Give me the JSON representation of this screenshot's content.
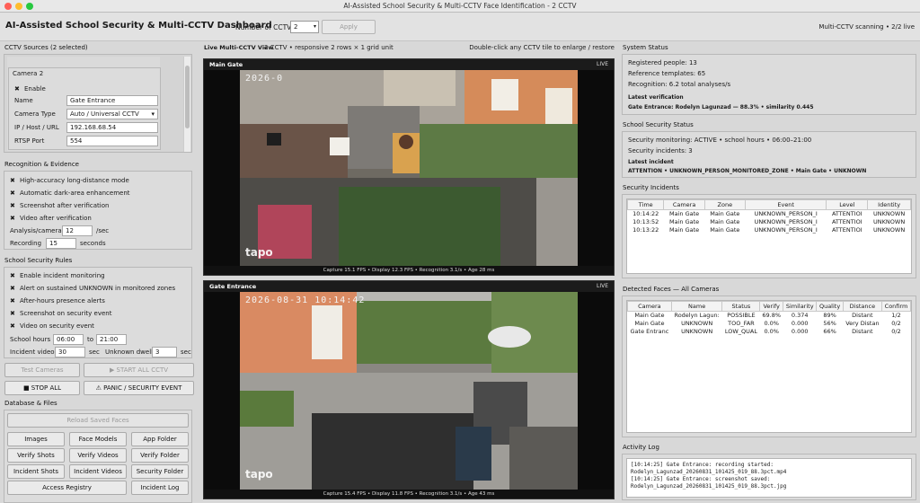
{
  "window": {
    "title": "AI-Assisted School Security & Multi-CCTV Face Identification - 2 CCTV"
  },
  "toolbar": {
    "app_title": "AI-Assisted School Security & Multi-CCTV Dashboard",
    "num_label": "Number of CCTV:",
    "num_value": "2",
    "apply": "Apply",
    "status": "Multi-CCTV scanning • 2/2 live"
  },
  "left": {
    "sources_title": "CCTV Sources (2 selected)",
    "cam_title": "Camera 2",
    "enable": "Enable",
    "name_label": "Name",
    "name_value": "Gate Entrance",
    "type_label": "Camera Type",
    "type_value": "Auto / Universal CCTV",
    "ip_label": "IP / Host / URL",
    "ip_value": "192.168.68.54",
    "port_label": "RTSP Port",
    "port_value": "554",
    "rec_title": "Recognition & Evidence",
    "rec_opts": [
      "High-accuracy long-distance mode",
      "Automatic dark-area enhancement",
      "Screenshot after verification",
      "Video after verification"
    ],
    "analysis_label": "Analysis/camera",
    "analysis_value": "12",
    "analysis_unit": "/sec",
    "recording_label": "Recording",
    "recording_value": "15",
    "recording_unit": "seconds",
    "rules_title": "School Security Rules",
    "rule_opts": [
      "Enable incident monitoring",
      "Alert on sustained UNKNOWN in monitored zones",
      "After-hours presence alerts",
      "Screenshot on security event",
      "Video on security event"
    ],
    "hours_label": "School hours",
    "hours_from": "06:00",
    "hours_to_label": "to",
    "hours_to": "21:00",
    "incvid_label": "Incident video",
    "incvid_value": "30",
    "sec1": "sec",
    "dwell_label": "Unknown dwell",
    "dwell_value": "3",
    "sec2": "sec",
    "test_btn": "Test Cameras",
    "start_btn": "▶ START ALL CCTV",
    "stop_btn": "■ STOP ALL",
    "panic_btn": "⚠ PANIC / SECURITY EVENT",
    "db_title": "Database & Files",
    "reload_btn": "Reload Saved Faces",
    "file_btns": [
      "Images",
      "Face Models",
      "App Folder",
      "Verify Shots",
      "Verify Videos",
      "Verify Folder",
      "Incident Shots",
      "Incident Videos",
      "Security Folder"
    ],
    "access_btn": "Access Registry",
    "incident_log_btn": "Incident Log"
  },
  "center": {
    "view_title": "Live Multi-CCTV View",
    "view_sub": "2 CCTV • responsive 2 rows × 1 grid unit",
    "view_hint": "Double-click any CCTV tile to enlarge / restore",
    "cam1": {
      "name": "Main Gate",
      "live": "LIVE",
      "ts": "2026-0",
      "foot": "Capture 15.1 FPS • Display 12.3 FPS • Recognition 3.1/s • Age 28 ms",
      "brand": "tapo"
    },
    "cam2": {
      "name": "Gate Entrance",
      "live": "LIVE",
      "ts": "2026-08-31 10:14:42",
      "foot": "Capture 15.4 FPS • Display 11.8 FPS • Recognition 3.1/s • Age 43 ms",
      "brand": "tapo"
    }
  },
  "right": {
    "sys_title": "System Status",
    "registered": "Registered people: 13",
    "templates": "Reference templates: 65",
    "recognition": "Recognition: 6.2 total analyses/s",
    "latest_ver_label": "Latest verification",
    "latest_ver": "Gate Entrance: Rodelyn Lagunzad — 88.3% • similarity 0.445",
    "sec_title": "School Security Status",
    "monitoring": "Security monitoring: ACTIVE • school hours • 06:00–21:00",
    "incidents": "Security incidents: 3",
    "latest_inc_label": "Latest incident",
    "latest_inc": "ATTENTION • UNKNOWN_PERSON_MONITORED_ZONE • Main Gate • UNKNOWN",
    "inc_title": "Security Incidents",
    "inc_cols": [
      "Time",
      "Camera",
      "Zone",
      "Event",
      "Level",
      "Identity"
    ],
    "inc_rows": [
      [
        "10:14:22",
        "Main Gate",
        "Main Gate",
        "UNKNOWN_PERSON_I",
        "ATTENTIOI",
        "UNKNOWN"
      ],
      [
        "10:13:52",
        "Main Gate",
        "Main Gate",
        "UNKNOWN_PERSON_I",
        "ATTENTIOI",
        "UNKNOWN"
      ],
      [
        "10:13:22",
        "Main Gate",
        "Main Gate",
        "UNKNOWN_PERSON_I",
        "ATTENTIOI",
        "UNKNOWN"
      ]
    ],
    "faces_title": "Detected Faces — All Cameras",
    "face_cols": [
      "Camera",
      "Name",
      "Status",
      "Verify",
      "Similarity",
      "Quality",
      "Distance",
      "Confirm"
    ],
    "face_rows": [
      [
        "Main Gate",
        "Rodelyn Lagun:",
        "POSSIBLE",
        "69.8%",
        "0.374",
        "89%",
        "Distant",
        "1/2"
      ],
      [
        "Main Gate",
        "UNKNOWN",
        "TOO_FAR",
        "0.0%",
        "0.000",
        "56%",
        "Very Distan",
        "0/2"
      ],
      [
        "Gate Entranc",
        "UNKNOWN",
        "LOW_QUAL",
        "0.0%",
        "0.000",
        "66%",
        "Distant",
        "0/2"
      ]
    ],
    "log_title": "Activity Log",
    "log_lines": "[10:14:25] Gate Entrance: recording started:\nRodelyn_Lagunzad_20260831_101425_019_88.3pct.mp4\n[10:14:25] Gate Entrance: screenshot saved:\nRodelyn_Lagunzad_20260831_101425_019_88.3pct.jpg"
  }
}
